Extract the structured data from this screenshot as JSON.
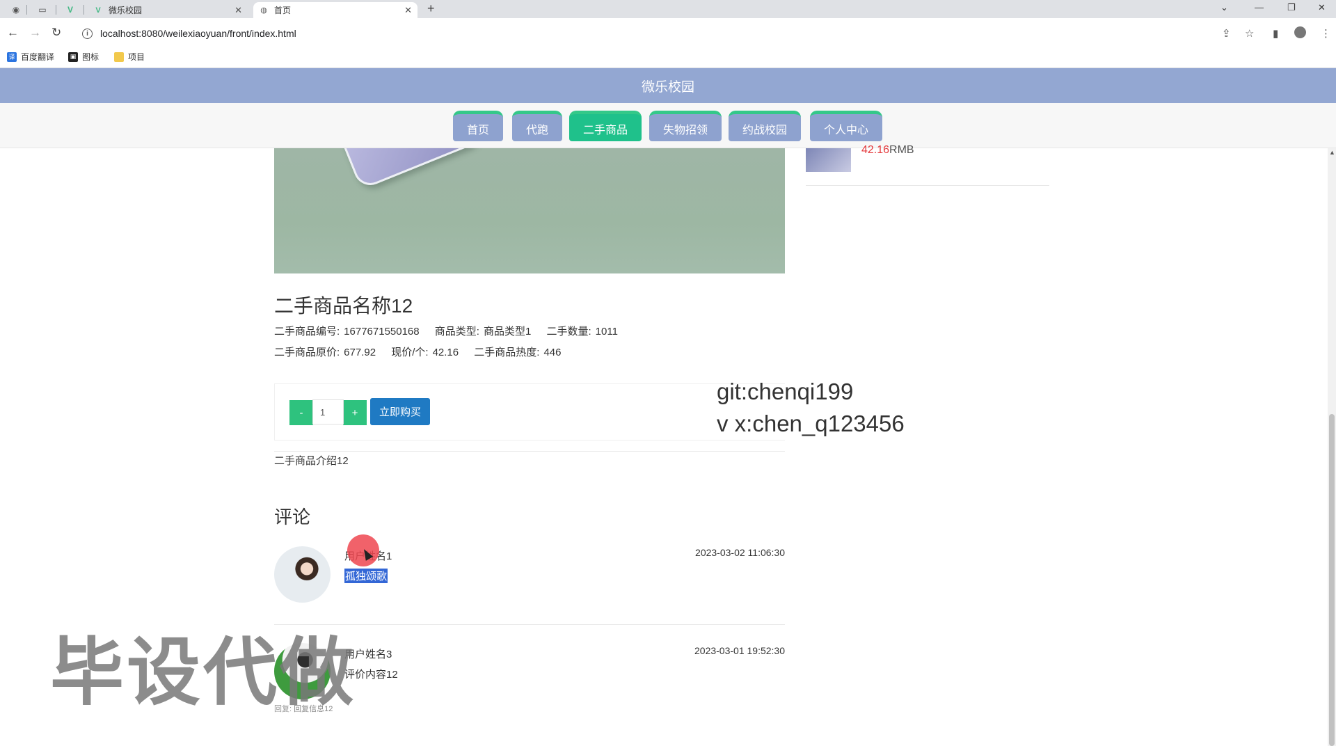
{
  "browser": {
    "tabs": [
      {
        "title": "微乐校园",
        "icon": "vue-logo-icon"
      },
      {
        "title": "首页",
        "icon": "globe-icon"
      }
    ],
    "new_tab": "+",
    "url": "localhost:8080/weilexiaoyuan/front/index.html",
    "bookmarks": [
      {
        "label": "百度翻译",
        "icon": "translate-icon"
      },
      {
        "label": "图标",
        "icon": "image-icon"
      },
      {
        "label": "项目",
        "icon": "folder-icon"
      }
    ]
  },
  "site": {
    "title": "微乐校园",
    "nav": [
      {
        "label": "首页",
        "active": false
      },
      {
        "label": "代跑",
        "active": false
      },
      {
        "label": "二手商品",
        "active": true
      },
      {
        "label": "失物招领",
        "active": false
      },
      {
        "label": "约战校园",
        "active": false
      },
      {
        "label": "个人中心",
        "active": false
      }
    ]
  },
  "sidebar": {
    "price_value": "42.16",
    "price_unit": "RMB"
  },
  "product": {
    "name": "二手商品名称12",
    "row1": {
      "code_label": "二手商品编号:",
      "code_value": "1677671550168",
      "type_label": "商品类型:",
      "type_value": "商品类型1",
      "qty_label": "二手数量:",
      "qty_value": "1011"
    },
    "row2": {
      "orig_label": "二手商品原价:",
      "orig_value": "677.92",
      "now_label": "现价/个:",
      "now_value": "42.16",
      "heat_label": "二手商品热度:",
      "heat_value": "446"
    },
    "qty_minus": "-",
    "qty_value": "1",
    "qty_plus": "+",
    "buy_label": "立即购买",
    "intro": "二手商品介绍12"
  },
  "comments": {
    "title": "评论",
    "items": [
      {
        "user": "用户姓名1",
        "content": "孤独颂歌",
        "time": "2023-03-02 11:06:30",
        "selected": true
      },
      {
        "user": "用户姓名3",
        "content": "评价内容12",
        "time": "2023-03-01 19:52:30",
        "reply_label": "回复:",
        "reply": "回复信息12"
      }
    ]
  },
  "overlays": {
    "git": "git:chenqi199",
    "vx": "v x:chen_q123456",
    "watermark": "毕设代做"
  },
  "colors": {
    "header": "#93a7d2",
    "nav_active": "#1fc18b",
    "buy_button": "#1f7ac3",
    "qty_button": "#2ec27e",
    "price": "#e4393c"
  }
}
